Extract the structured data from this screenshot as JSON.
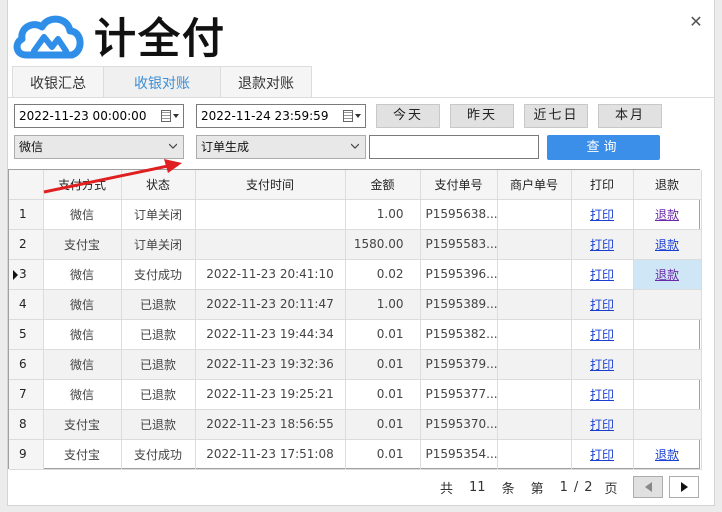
{
  "app": {
    "name": "计全付",
    "close_glyph": "✕"
  },
  "tabs": [
    {
      "label": "收银汇总",
      "active": false
    },
    {
      "label": "收银对账",
      "active": true
    },
    {
      "label": "退款对账",
      "active": false
    }
  ],
  "filters": {
    "start_datetime": "2022-11-23 00:00:00",
    "end_datetime": "2022-11-24 23:59:59",
    "pay_method": "微信",
    "order_status": "订单生成",
    "order_no_input": "",
    "quick": {
      "today": "今天",
      "yesterday": "昨天",
      "last7": "近七日",
      "month": "本月"
    },
    "search_label": "查询"
  },
  "table": {
    "headers": [
      "",
      "支付方式",
      "状态",
      "支付时间",
      "金额",
      "支付单号",
      "商户单号",
      "打印",
      "退款"
    ],
    "rows": [
      {
        "no": "1",
        "method": "微信",
        "status": "订单关闭",
        "time": "",
        "amount": "1.00",
        "pay_no": "P1595638...",
        "merchant_no": "",
        "print": "打印",
        "refund": "退款"
      },
      {
        "no": "2",
        "method": "支付宝",
        "status": "订单关闭",
        "time": "",
        "amount": "1580.00",
        "pay_no": "P1595583...",
        "merchant_no": "",
        "print": "打印",
        "refund": "退款"
      },
      {
        "no": "3",
        "method": "微信",
        "status": "支付成功",
        "time": "2022-11-23 20:41:10",
        "amount": "0.02",
        "pay_no": "P1595396...",
        "merchant_no": "",
        "print": "打印",
        "refund": "退款"
      },
      {
        "no": "4",
        "method": "微信",
        "status": "已退款",
        "time": "2022-11-23 20:11:47",
        "amount": "1.00",
        "pay_no": "P1595389...",
        "merchant_no": "",
        "print": "打印",
        "refund": ""
      },
      {
        "no": "5",
        "method": "微信",
        "status": "已退款",
        "time": "2022-11-23 19:44:34",
        "amount": "0.01",
        "pay_no": "P1595382...",
        "merchant_no": "",
        "print": "打印",
        "refund": ""
      },
      {
        "no": "6",
        "method": "微信",
        "status": "已退款",
        "time": "2022-11-23 19:32:36",
        "amount": "0.01",
        "pay_no": "P1595379...",
        "merchant_no": "",
        "print": "打印",
        "refund": ""
      },
      {
        "no": "7",
        "method": "微信",
        "status": "已退款",
        "time": "2022-11-23 19:25:21",
        "amount": "0.01",
        "pay_no": "P1595377...",
        "merchant_no": "",
        "print": "打印",
        "refund": ""
      },
      {
        "no": "8",
        "method": "支付宝",
        "status": "已退款",
        "time": "2022-11-23 18:56:55",
        "amount": "0.01",
        "pay_no": "P1595370...",
        "merchant_no": "",
        "print": "打印",
        "refund": ""
      },
      {
        "no": "9",
        "method": "支付宝",
        "status": "支付成功",
        "time": "2022-11-23 17:51:08",
        "amount": "0.01",
        "pay_no": "P1595354...",
        "merchant_no": "",
        "print": "打印",
        "refund": "退款"
      }
    ],
    "selected_row": 2
  },
  "pager": {
    "total_prefix": "共",
    "total": "11",
    "total_unit": "条",
    "page_prefix": "第",
    "page": "1",
    "separator": "/",
    "pages": "2",
    "page_unit": "页"
  },
  "colors": {
    "accent": "#3b8fe8",
    "link": "#1a3fd1",
    "annotation_arrow": "#e02020",
    "logo": "#2f8ee8"
  },
  "icons": [
    "cloud-logo-icon",
    "close-icon",
    "calendar-icon",
    "chevron-down-icon",
    "row-pointer-icon",
    "prev-page-icon",
    "next-page-icon",
    "annotation-arrow"
  ]
}
